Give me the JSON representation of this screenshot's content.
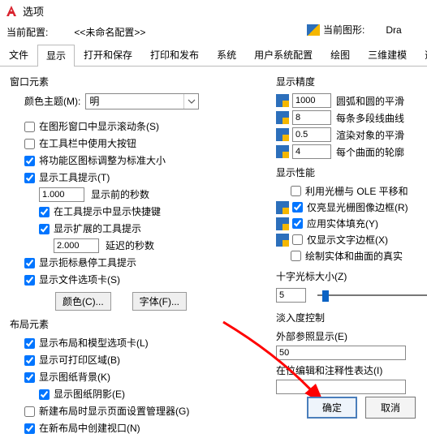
{
  "window": {
    "title": "选项",
    "app_letter": "A"
  },
  "profile": {
    "current_label": "当前配置:",
    "current_value": "<<未命名配置>>",
    "drawing_label": "当前图形:",
    "drawing_value": "Dra"
  },
  "tabs": [
    "文件",
    "显示",
    "打开和保存",
    "打印和发布",
    "系统",
    "用户系统配置",
    "绘图",
    "三维建模",
    "选择集"
  ],
  "activeTab": 1,
  "left": {
    "window_group": "窗口元素",
    "color_theme_label": "颜色主题(M):",
    "color_theme_value": "明",
    "chk_scrollbars": "在图形窗口中显示滚动条(S)",
    "chk_bigbtn": "在工具栏中使用大按钮",
    "chk_ribbon_std": "将功能区图标调整为标准大小",
    "chk_tooltips": "显示工具提示(T)",
    "sec_before": "1.000",
    "sec_before_label": "显示前的秒数",
    "chk_shortcut": "在工具提示中显示快捷键",
    "chk_ext_tip": "显示扩展的工具提示",
    "delay_sec": "2.000",
    "delay_sec_label": "延迟的秒数",
    "chk_hover_tip": "显示扼标悬停工具提示",
    "chk_file_tabs": "显示文件选项卡(S)",
    "btn_colors": "颜色(C)...",
    "btn_fonts": "字体(F)...",
    "layout_group": "布局元素",
    "chk_layout_model": "显示布局和模型选项卡(L)",
    "chk_printable": "显示可打印区域(B)",
    "chk_paper_bg": "显示图纸背景(K)",
    "chk_paper_shadow": "显示图纸阴影(E)",
    "chk_page_setup": "新建布局时显示页面设置管理器(G)",
    "chk_viewport": "在新布局中创建视口(N)"
  },
  "right": {
    "precision_group": "显示精度",
    "arc": "1000",
    "arc_label": "圆弧和圆的平滑",
    "poly": "8",
    "poly_label": "每条多段线曲线",
    "render": "0.5",
    "render_label": "渲染对象的平滑",
    "surf": "4",
    "surf_label": "每个曲面的轮廓",
    "perf_group": "显示性能",
    "chk_ole": "利用光栅与 OLE 平移和",
    "chk_raster_frame": "仅亮显光栅图像边框(R)",
    "chk_solid_fill": "应用实体填充(Y)",
    "chk_text_frame": "仅显示文字边框(X)",
    "chk_draw_true": "绘制实体和曲面的真实",
    "crosshair_group": "十字光标大小(Z)",
    "crosshair_value": "5",
    "fade_group": "淡入度控制",
    "xref_label": "外部参照显示(E)",
    "xref_value": "50",
    "inplace_label": "在位编辑和注释性表达(I)"
  },
  "footer": {
    "ok": "确定",
    "cancel": "取消"
  }
}
